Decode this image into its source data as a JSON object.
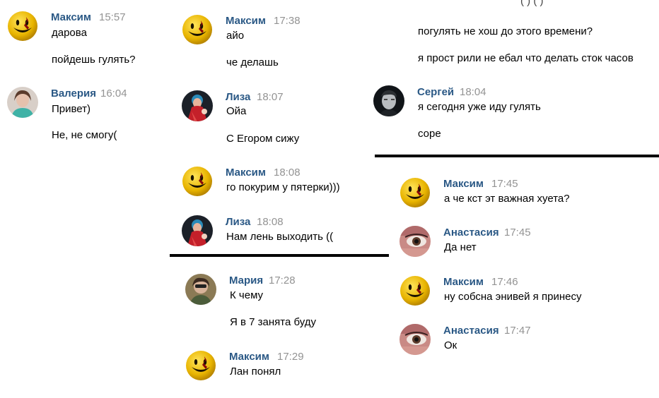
{
  "panel1": {
    "messages": [
      {
        "author": "Максим",
        "time": "15:57",
        "avatar": "smiley-avatar",
        "lines": [
          "дарова",
          "пойдешь гулять?"
        ]
      },
      {
        "author": "Валерия",
        "time": "16:04",
        "avatar": "valeria-photo",
        "lines": [
          "Привет)",
          "Не, не смогу("
        ]
      }
    ]
  },
  "panel2": {
    "messages": [
      {
        "author": "Максим",
        "time": "17:38",
        "avatar": "smiley-avatar",
        "lines": [
          "айо",
          "че делашь"
        ]
      },
      {
        "author": "Лиза",
        "time": "18:07",
        "avatar": "liza-photo",
        "lines": [
          "Ойа",
          "С Егором сижу"
        ]
      },
      {
        "author": "Максим",
        "time": "18:08",
        "avatar": "smiley-avatar",
        "lines": [
          "го покурим у пятерки)))"
        ]
      },
      {
        "author": "Лиза",
        "time": "18:08",
        "avatar": "liza-photo",
        "lines": [
          "Нам лень выходить (("
        ]
      }
    ]
  },
  "panel3": {
    "messages": [
      {
        "author": "Мария",
        "time": "17:28",
        "avatar": "maria-photo",
        "lines": [
          "К чему",
          "Я в 7 занята буду"
        ]
      },
      {
        "author": "Максим",
        "time": "17:29",
        "avatar": "smiley-avatar",
        "lines": [
          "Лан понял"
        ]
      }
    ]
  },
  "panel4": {
    "cut_top_line": "(                ) (     )",
    "prev_lines": [
      "погулять не хош до этого времени?",
      "я прост рили не ебал что делать сток часов"
    ],
    "messages": [
      {
        "author": "Сергей",
        "time": "18:04",
        "avatar": "sergey-photo",
        "lines": [
          "я сегодня уже иду гулять",
          "соре"
        ]
      }
    ]
  },
  "panel5": {
    "messages": [
      {
        "author": "Максим",
        "time": "17:45",
        "avatar": "smiley-avatar",
        "lines": [
          "а че кст эт важная хуета?"
        ]
      },
      {
        "author": "Анастасия",
        "time": "17:45",
        "avatar": "anastasia-photo",
        "lines": [
          "Да нет"
        ]
      },
      {
        "author": "Максим",
        "time": "17:46",
        "avatar": "smiley-avatar",
        "lines": [
          "ну собсна энивей я принесу"
        ]
      },
      {
        "author": "Анастасия",
        "time": "17:47",
        "avatar": "anastasia-photo",
        "lines": [
          "Ок"
        ]
      }
    ]
  },
  "colors": {
    "author": "#2a5885",
    "time": "#939393",
    "text": "#000000",
    "divider": "#000000"
  }
}
